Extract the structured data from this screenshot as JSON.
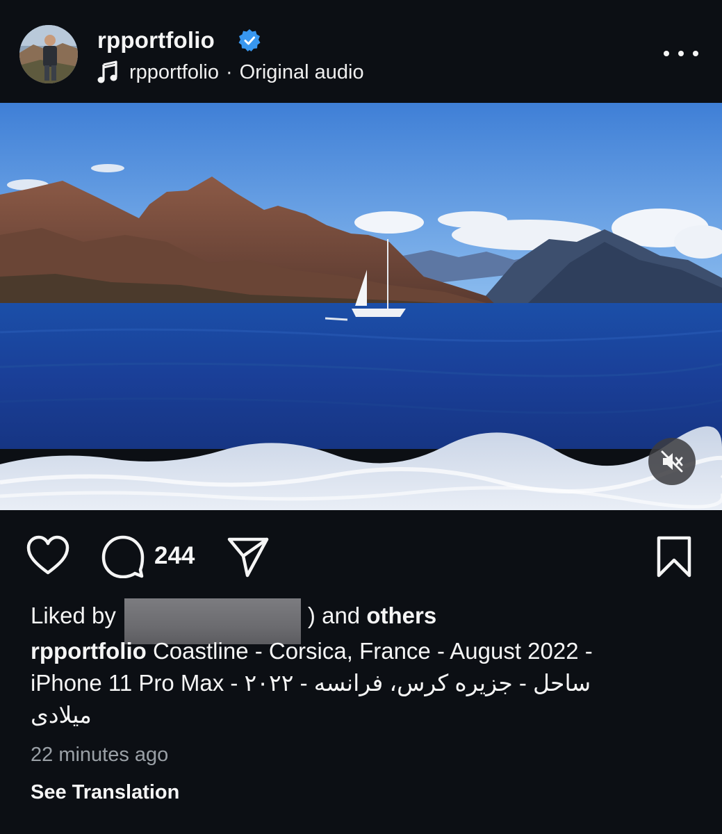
{
  "post": {
    "username": "rpportfolio",
    "verified": true,
    "audio": {
      "artist": "rpportfolio",
      "separator": "·",
      "label": "Original audio"
    },
    "more_icon": "more-horizontal-icon"
  },
  "media": {
    "scene": "sea-coastline-photo",
    "mute_icon": "speaker-muted-icon"
  },
  "actions": {
    "like_icon": "heart-icon",
    "comment_icon": "comment-bubble-icon",
    "comment_count": "244",
    "share_icon": "paper-plane-icon",
    "save_icon": "bookmark-icon"
  },
  "likes": {
    "prefix": "Liked by",
    "trailing_char": ")",
    "middle": " and ",
    "others": "others"
  },
  "caption": {
    "username": "rpportfolio",
    "line1": "Coastline - Corsica, France - August 2022 -",
    "line2_latin": "iPhone 11 Pro Max - ",
    "line2_persian": "ساحل - جزیره کرس، فرانسه - ۲۰۲۲",
    "line3": "میلادی"
  },
  "timestamp": "22 minutes ago",
  "see_translation": "See Translation",
  "colors": {
    "background": "#0c0f14",
    "text": "#f5f5f5",
    "muted_text": "#9aa0a6",
    "verified_badge": "#3897f0"
  }
}
